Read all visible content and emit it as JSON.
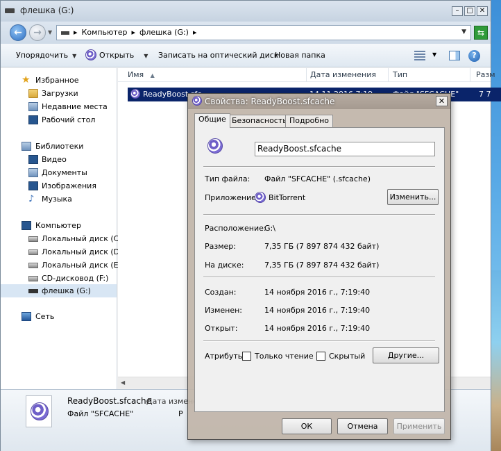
{
  "explorer": {
    "title": "флешка (G:)",
    "breadcrumbs": [
      "Компьютер",
      "флешка (G:)"
    ],
    "toolbar": {
      "organize": "Упорядочить",
      "open": "Открыть",
      "burn": "Записать на оптический диск",
      "new_folder": "Новая папка"
    },
    "sidebar": {
      "favorites": "Избранное",
      "downloads": "Загрузки",
      "recent": "Недавние места",
      "desktop": "Рабочий стол",
      "libraries": "Библиотеки",
      "video": "Видео",
      "documents": "Документы",
      "images": "Изображения",
      "music": "Музыка",
      "computer": "Компьютер",
      "drive_c": "Локальный диск (C:)",
      "drive_d": "Локальный диск (D:)",
      "drive_e": "Локальный диск (E:)",
      "drive_f": "CD-дисковод (F:)",
      "drive_g": "флешка (G:)",
      "network": "Сеть"
    },
    "columns": {
      "name": "Имя",
      "date": "Дата изменения",
      "type": "Тип",
      "size": "Разм"
    },
    "files": [
      {
        "name": "ReadyBoost.sfc",
        "date": "14.11.2016 7:19",
        "type": "Файл \"SFCACHE\"",
        "size": "7 7"
      }
    ],
    "details": {
      "name": "ReadyBoost.sfcache",
      "date_label": "Дата измене",
      "type": "Файл \"SFCACHE\"",
      "extra": "Р"
    }
  },
  "dialog": {
    "title": "Свойства: ReadyBoost.sfcache",
    "tabs": [
      "Общие",
      "Безопасность",
      "Подробно"
    ],
    "filename": "ReadyBoost.sfcache",
    "type_label": "Тип файла:",
    "type_value": "Файл \"SFCACHE\" (.sfcache)",
    "app_label": "Приложение:",
    "app_value": "BitTorrent",
    "change_button": "Изменить...",
    "location_label": "Расположение:",
    "location_value": "G:\\",
    "size_label": "Размер:",
    "size_value": "7,35 ГБ (7 897 874 432 байт)",
    "disk_label": "На диске:",
    "disk_value": "7,35 ГБ (7 897 874 432 байт)",
    "created_label": "Создан:",
    "created_value": "14 ноября 2016 г., 7:19:40",
    "modified_label": "Изменен:",
    "modified_value": "14 ноября 2016 г., 7:19:40",
    "opened_label": "Открыт:",
    "opened_value": "14 ноября 2016 г., 7:19:40",
    "attributes_label": "Атрибуты:",
    "readonly_label": "Только чтение",
    "hidden_label": "Скрытый",
    "other_button": "Другие...",
    "ok_button": "ОК",
    "cancel_button": "Отмена",
    "apply_button": "Применить"
  }
}
